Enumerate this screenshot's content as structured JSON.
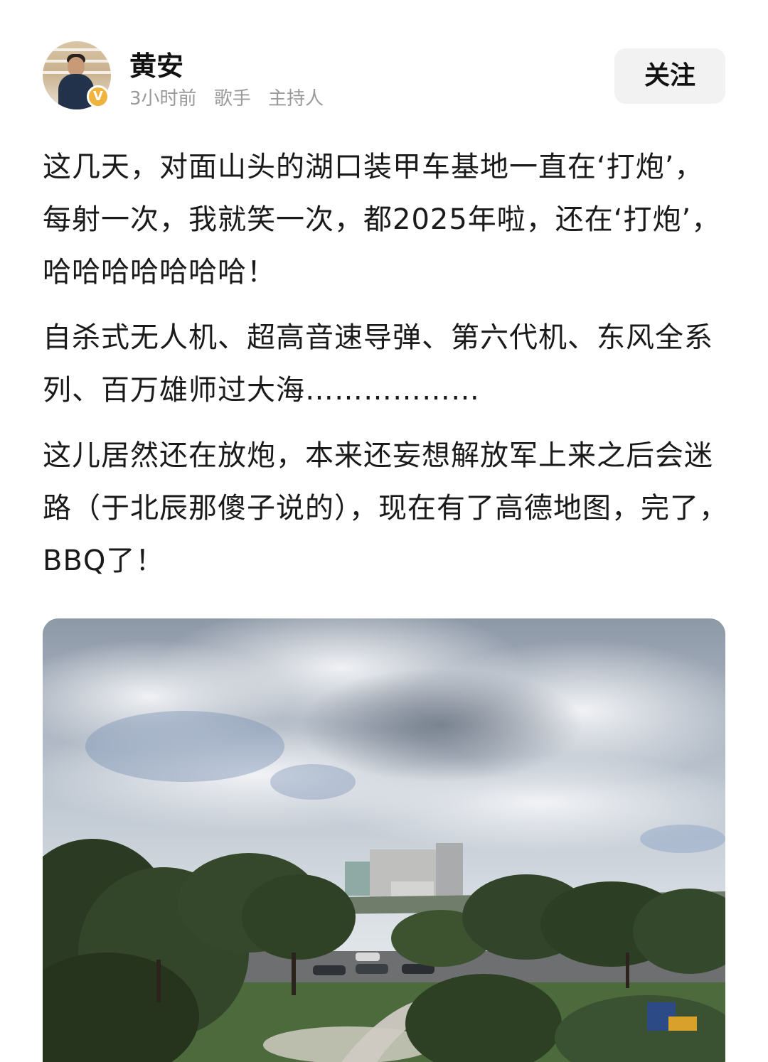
{
  "author": {
    "name": "黄安",
    "badge": "V",
    "time": "3小时前",
    "tags": [
      "歌手",
      "主持人"
    ]
  },
  "follow_label": "关注",
  "post": {
    "paragraphs": [
      "这几天，对面山头的湖口装甲车基地一直在‘打炮’，每射一次，我就笑一次，都2025年啦，还在‘打炮’，哈哈哈哈哈哈哈！",
      "自杀式无人机、超高音速导弹、第六代机、东风全系列、百万雄师过大海………………",
      "这儿居然还在放炮，本来还妄想解放军上来之后会迷路（于北辰那傻子说的），现在有了高德地图，完了，BBQ了！"
    ]
  },
  "colors": {
    "badge": "#f0b43c",
    "button_bg": "#f2f2f2",
    "meta_text": "#9a9a9a"
  }
}
